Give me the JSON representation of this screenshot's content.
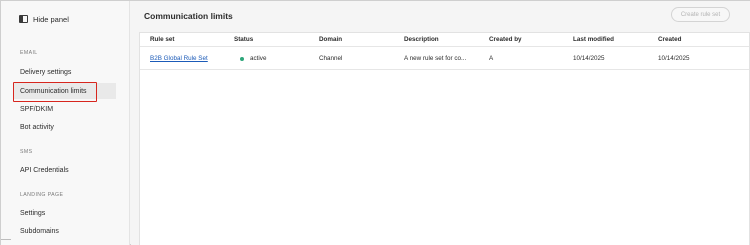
{
  "sidebar": {
    "hide_panel_label": "Hide panel",
    "sections": [
      {
        "heading": "EMAIL",
        "items": [
          "Delivery settings",
          "Communication limits",
          "SPF/DKIM",
          "Bot activity"
        ]
      },
      {
        "heading": "SMS",
        "items": [
          "API Credentials"
        ]
      },
      {
        "heading": "LANDING PAGE",
        "items": [
          "Settings",
          "Subdomains"
        ]
      }
    ],
    "selected_item": "Communication limits"
  },
  "main": {
    "title": "Communication limits",
    "create_button_label": "Create rule set",
    "table": {
      "columns": [
        "Rule set",
        "Status",
        "Domain",
        "Description",
        "Created by",
        "Last modified",
        "Created"
      ],
      "rows": [
        {
          "rule_set": "B2B Global Rule Set",
          "status": "active",
          "domain": "Channel",
          "description": "A new rule set for co...",
          "created_by": "A",
          "last_modified": "10/14/2025",
          "created": "10/14/2025"
        }
      ]
    }
  },
  "colors": {
    "accent_link": "#1c5bb8",
    "status_active": "#2da67a",
    "selection_outline": "#d7261e"
  }
}
